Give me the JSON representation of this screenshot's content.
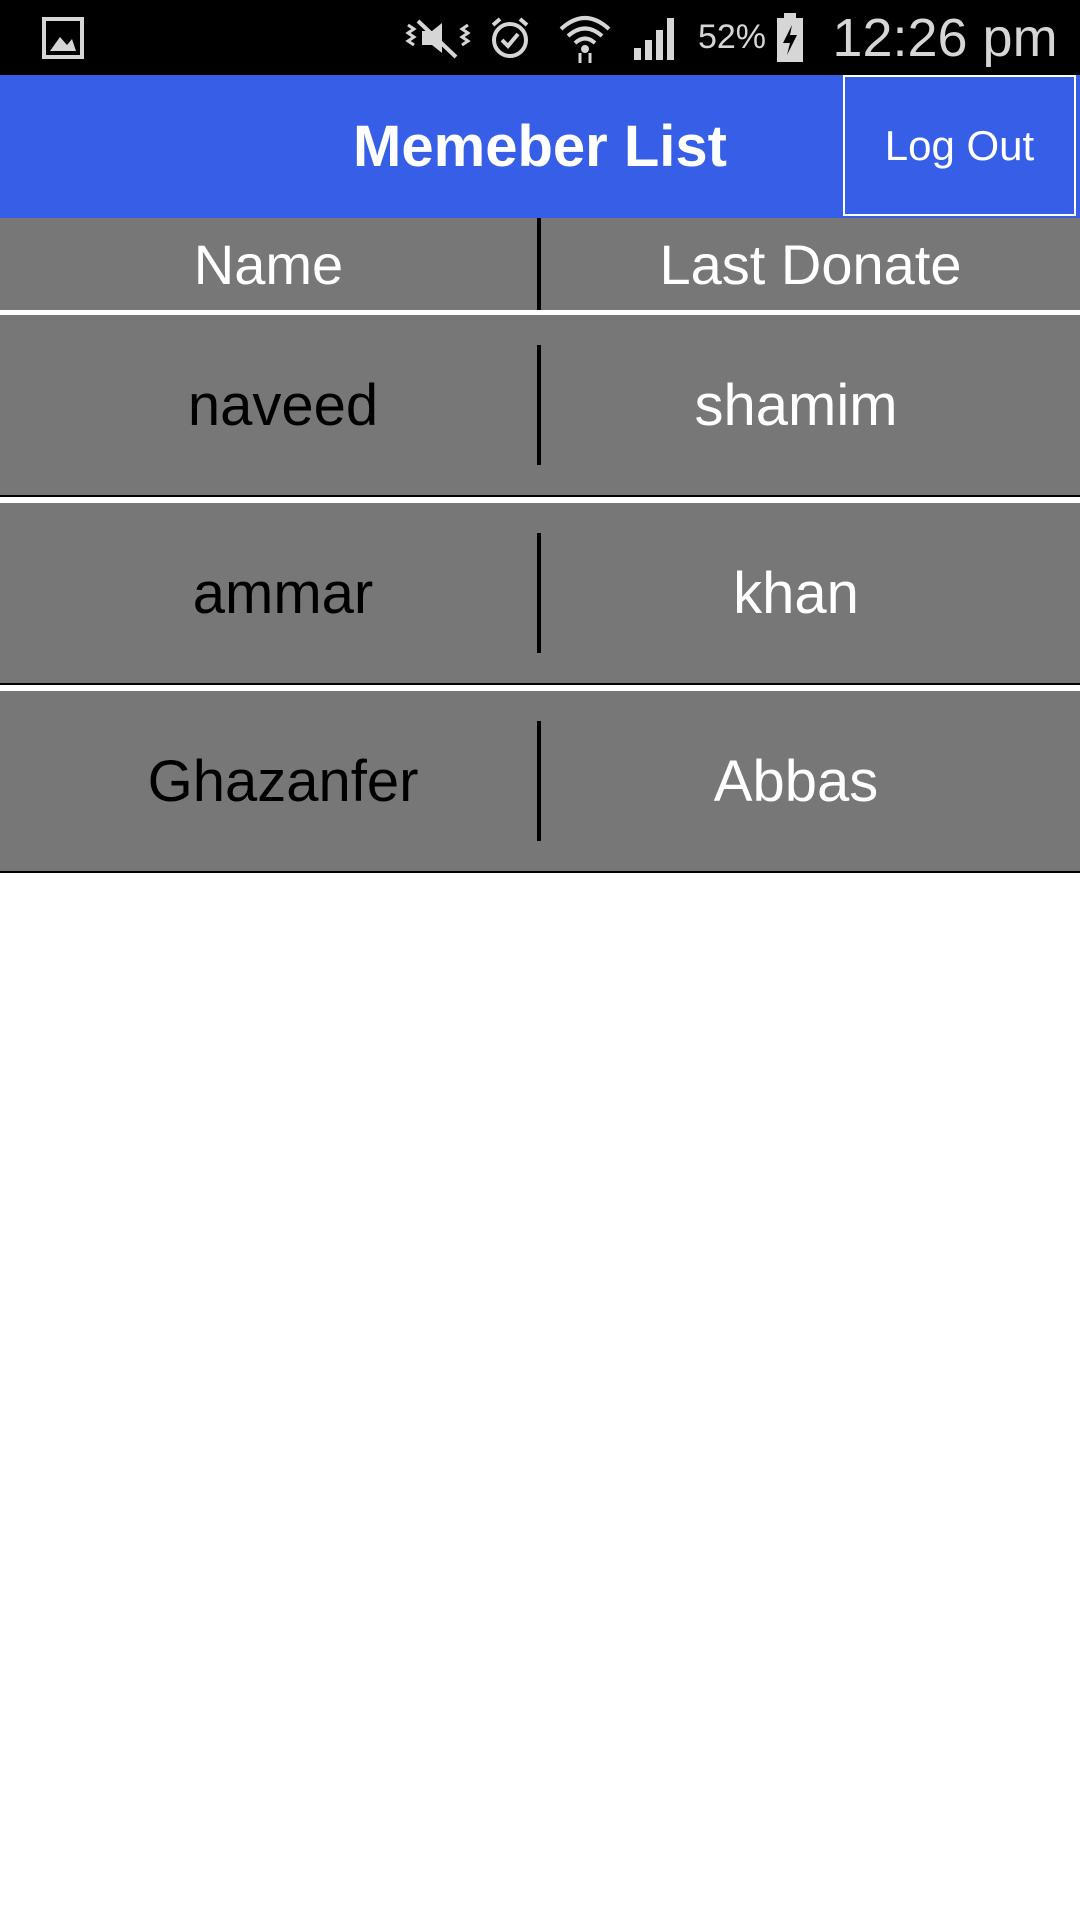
{
  "status_bar": {
    "battery_percent": "52%",
    "time": "12:26 pm",
    "icons": [
      "gallery-icon",
      "vibrate-mute-icon",
      "alarm-icon",
      "wifi-icon",
      "signal-icon",
      "battery-charging-icon"
    ]
  },
  "app_bar": {
    "title": "Memeber List",
    "logout_label": "Log Out",
    "color": "#365ee7"
  },
  "table": {
    "headers": [
      "Name",
      "Last Donate"
    ],
    "rows": [
      {
        "name": "naveed",
        "last_donate": "shamim"
      },
      {
        "name": "ammar",
        "last_donate": "khan"
      },
      {
        "name": "Ghazanfer",
        "last_donate": "Abbas"
      }
    ],
    "row_color": "#777777"
  }
}
